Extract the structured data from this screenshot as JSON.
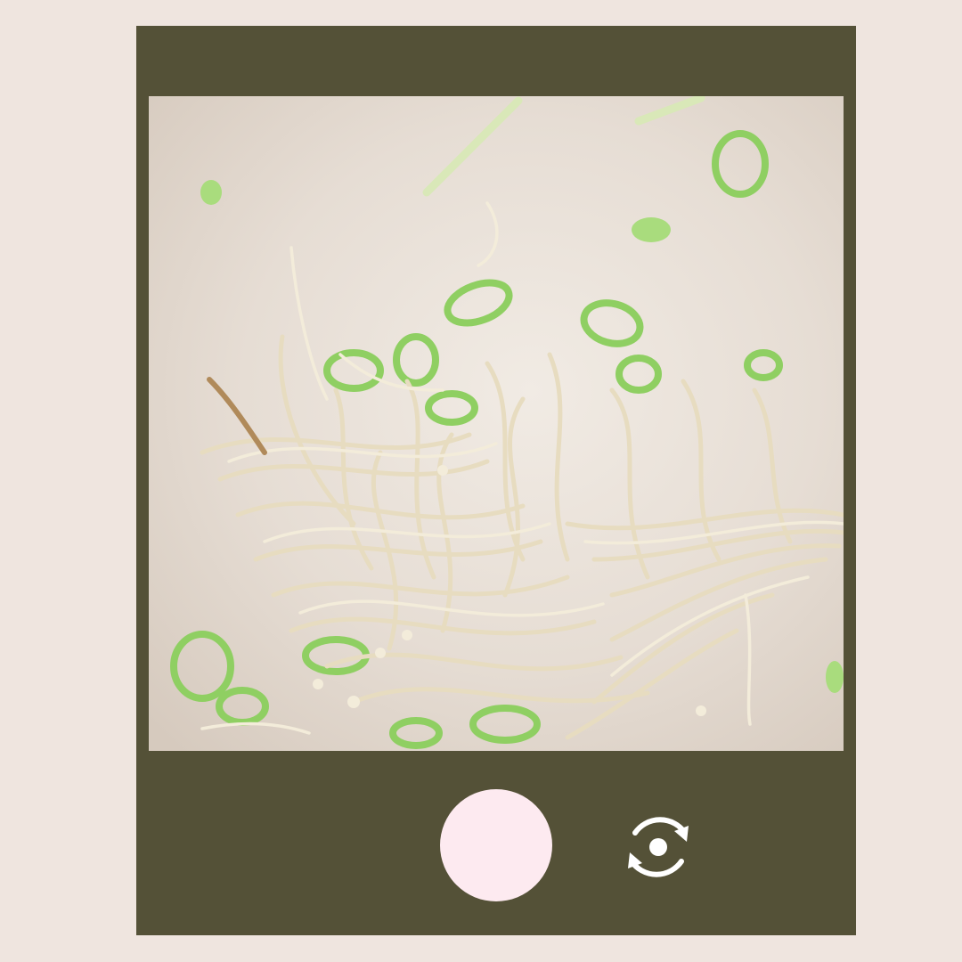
{
  "camera": {
    "frame_color": "#545137",
    "background_color": "#efe5df",
    "viewfinder_subject": "photo",
    "shutter": {
      "icon": "shutter-button",
      "color": "#fdeaf0"
    },
    "flip_camera": {
      "icon": "flip-camera-icon",
      "color": "#ffffff"
    }
  }
}
